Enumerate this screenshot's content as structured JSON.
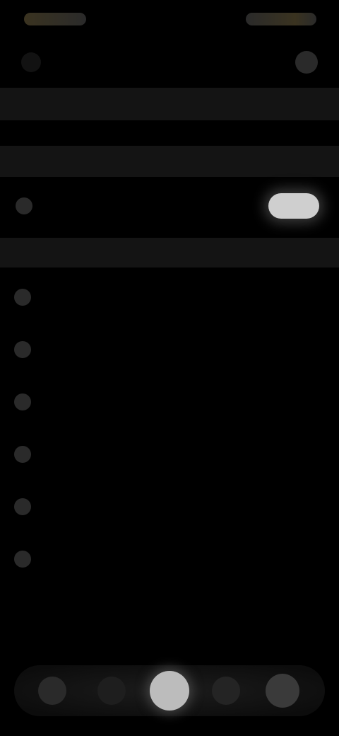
{
  "status": {
    "left_text": "",
    "right_text": ""
  },
  "header": {
    "title": ""
  },
  "sections": [
    {
      "label": ""
    },
    {
      "label": ""
    },
    {
      "label": ""
    }
  ],
  "toggle_row": {
    "label": "",
    "enabled": true
  },
  "list": [
    {
      "label": ""
    },
    {
      "label": ""
    },
    {
      "label": ""
    },
    {
      "label": ""
    },
    {
      "label": ""
    },
    {
      "label": ""
    }
  ],
  "footer": {
    "line1": "",
    "line2": ""
  },
  "colors": {
    "background": "#000000",
    "accent": "#3a3320",
    "toggle_on": "#cfcfcf"
  }
}
